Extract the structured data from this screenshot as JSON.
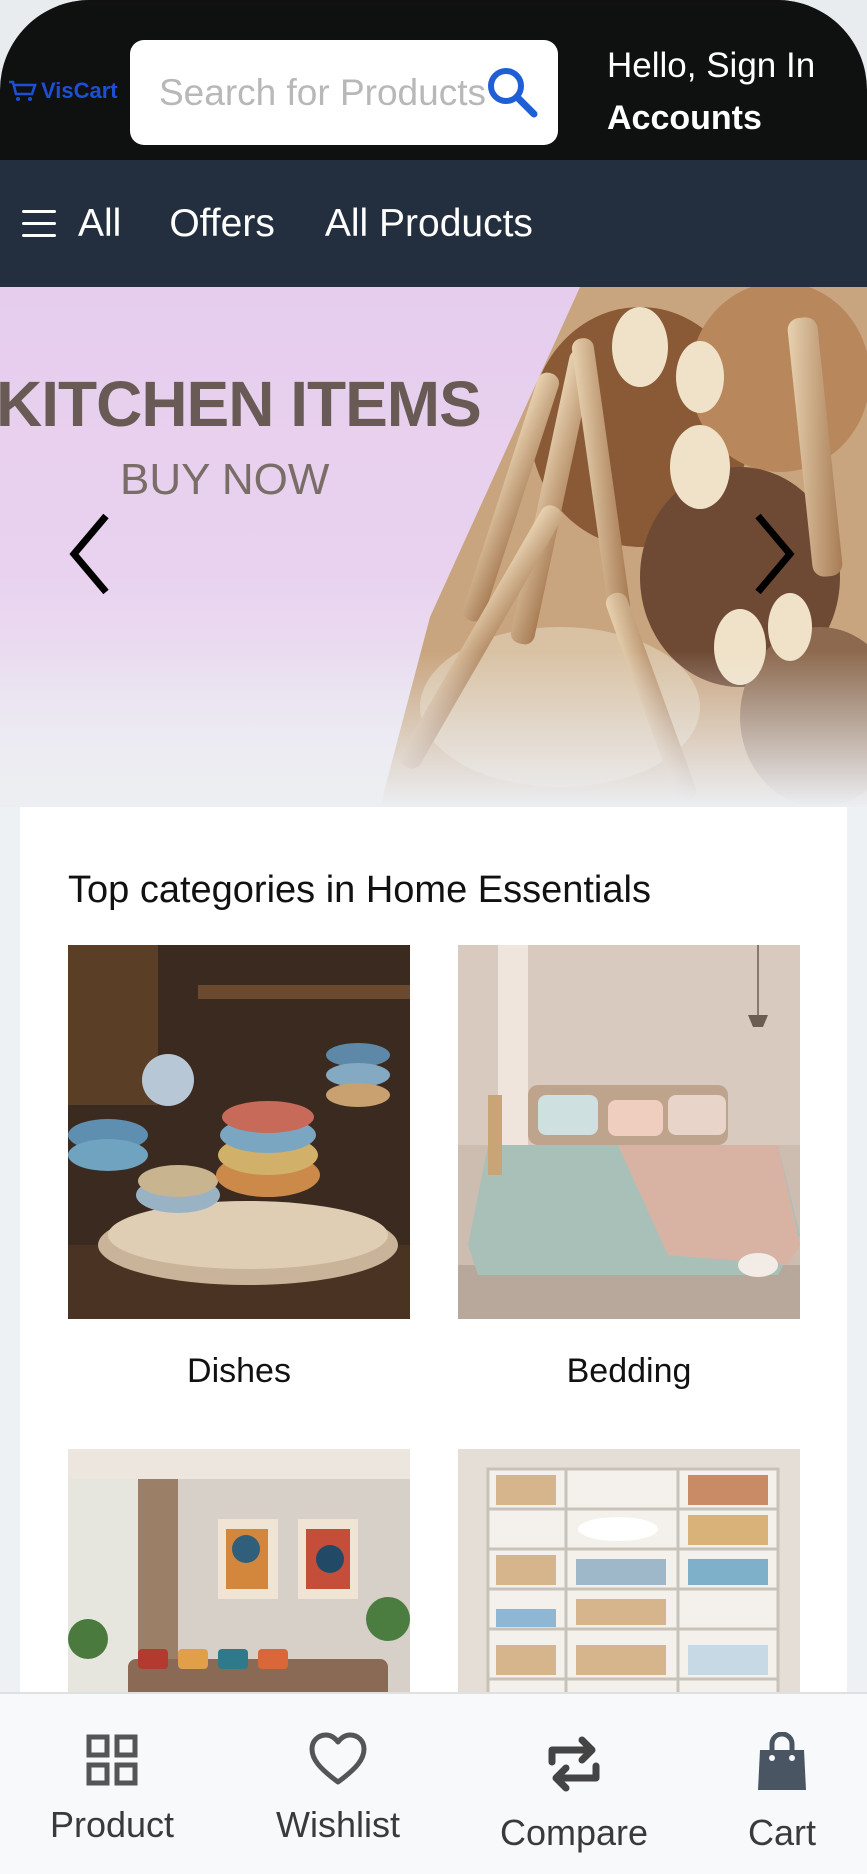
{
  "header": {
    "logo_text": "VisCart",
    "search_placeholder": "Search for Products",
    "greeting": "Hello, Sign In",
    "accounts": "Accounts"
  },
  "nav": {
    "all": "All",
    "offers": "Offers",
    "all_products": "All Products"
  },
  "hero": {
    "title": "KITCHEN ITEMS",
    "cta": "BUY NOW"
  },
  "categories": {
    "title": "Top categories in Home Essentials",
    "items": [
      {
        "label": "Dishes"
      },
      {
        "label": "Bedding"
      },
      {
        "label": ""
      },
      {
        "label": ""
      }
    ]
  },
  "tabs": [
    {
      "label": "Product",
      "icon": "grid-icon"
    },
    {
      "label": "Wishlist",
      "icon": "heart-icon"
    },
    {
      "label": "Compare",
      "icon": "compare-icon"
    },
    {
      "label": "Cart",
      "icon": "shopping-bag-icon"
    }
  ],
  "colors": {
    "header_bg": "#0f1111",
    "nav_bg": "#232f3e",
    "brand_blue": "#1c4fd6",
    "hero_bg": "#e6cdee"
  }
}
